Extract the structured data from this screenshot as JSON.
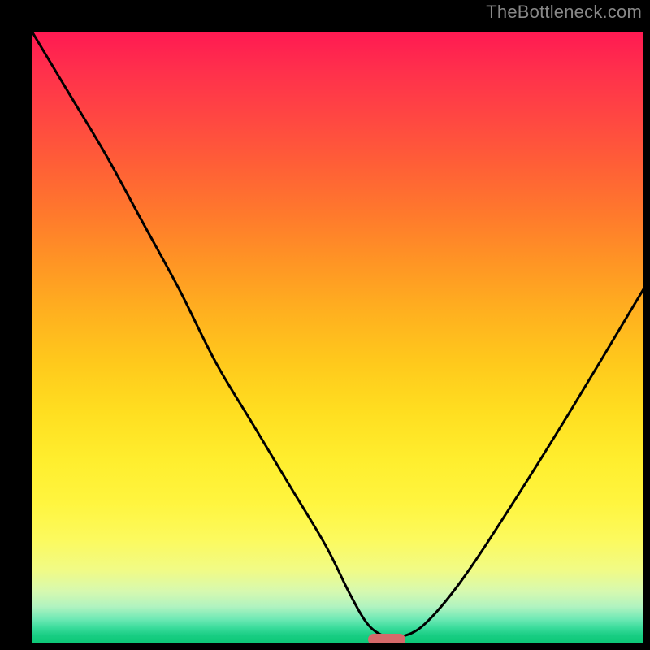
{
  "watermark": "TheBottleneck.com",
  "colors": {
    "page_bg": "#000000",
    "curve": "#000000",
    "marker": "#d56a6a",
    "watermark_text": "#888888"
  },
  "chart_data": {
    "type": "line",
    "title": "",
    "xlabel": "",
    "ylabel": "",
    "xlim": [
      0,
      100
    ],
    "ylim": [
      0,
      100
    ],
    "grid": false,
    "legend": false,
    "series": [
      {
        "name": "bottleneck-curve",
        "x": [
          0,
          6,
          12,
          18,
          24,
          30,
          36,
          42,
          48,
          52,
          55,
          58,
          60,
          64,
          70,
          78,
          88,
          100
        ],
        "values": [
          100,
          90,
          80,
          69,
          58,
          46,
          36,
          26,
          16,
          8,
          3,
          1,
          1,
          3,
          10,
          22,
          38,
          58
        ]
      }
    ],
    "marker": {
      "x": 58,
      "y": 0.7,
      "shape": "pill"
    },
    "background_gradient": {
      "top": "#ff1a52",
      "mid": "#ffde20",
      "bottom": "#0cc876"
    }
  }
}
